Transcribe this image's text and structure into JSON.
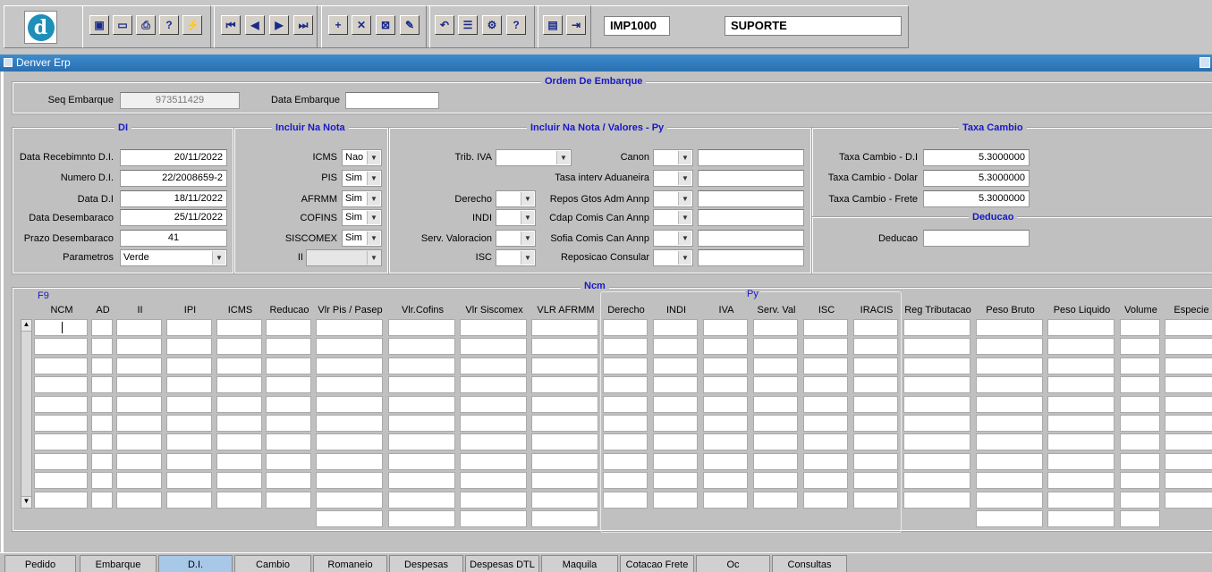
{
  "toolbar": {
    "module_code": "IMP1000",
    "user": "SUPORTE"
  },
  "window": {
    "title": "Denver Erp"
  },
  "ordem": {
    "title": "Ordem De Embarque",
    "seq_label": "Seq Embarque",
    "seq_value": "973511429",
    "data_label": "Data Embarque",
    "data_value": ""
  },
  "di": {
    "title": "DI",
    "rows": [
      {
        "label": "Data Recebimnto D.I.",
        "value": "20/11/2022"
      },
      {
        "label": "Numero D.I.",
        "value": "22/2008659-2"
      },
      {
        "label": "Data D.I",
        "value": "18/11/2022"
      },
      {
        "label": "Data Desembaraco",
        "value": "25/11/2022"
      },
      {
        "label": "Prazo Desembaraco",
        "value": "41"
      }
    ],
    "parametros_label": "Parametros",
    "parametros_value": "Verde"
  },
  "nota": {
    "title": "Incluir Na Nota",
    "rows": [
      {
        "label": "ICMS",
        "value": "Nao"
      },
      {
        "label": "PIS",
        "value": "Sim"
      },
      {
        "label": "AFRMM",
        "value": "Sim"
      },
      {
        "label": "COFINS",
        "value": "Sim"
      },
      {
        "label": "SISCOMEX",
        "value": "Sim"
      },
      {
        "label": "II",
        "value": ""
      }
    ]
  },
  "py": {
    "title": "Incluir Na Nota / Valores - Py",
    "left": [
      {
        "label": "Trib. IVA",
        "value": ""
      },
      {
        "label": "Derecho",
        "value": ""
      },
      {
        "label": "INDI",
        "value": ""
      },
      {
        "label": "Serv. Valoracion",
        "value": ""
      },
      {
        "label": "ISC",
        "value": ""
      }
    ],
    "right": [
      {
        "label": "Canon"
      },
      {
        "label": "Tasa interv Aduaneira"
      },
      {
        "label": "Repos Gtos Adm Annp"
      },
      {
        "label": "Cdap Comis Can Annp"
      },
      {
        "label": "Sofia Comis Can Annp"
      },
      {
        "label": "Reposicao Consular"
      }
    ]
  },
  "taxa": {
    "title": "Taxa Cambio",
    "rows": [
      {
        "label": "Taxa Cambio - D.I",
        "value": "5.3000000"
      },
      {
        "label": "Taxa Cambio - Dolar",
        "value": "5.3000000"
      },
      {
        "label": "Taxa Cambio - Frete",
        "value": "5.3000000"
      }
    ]
  },
  "deducao": {
    "title": "Deducao",
    "label": "Deducao",
    "value": ""
  },
  "ncm": {
    "title": "Ncm",
    "f9": "F9",
    "py_title": "Py",
    "columns": [
      "NCM",
      "AD",
      "II",
      "IPI",
      "ICMS",
      "Reducao",
      "Vlr Pis / Pasep",
      "Vlr.Cofins",
      "Vlr Siscomex",
      "VLR AFRMM",
      "Derecho",
      "INDI",
      "IVA",
      "Serv. Val",
      "ISC",
      "IRACIS",
      "Reg Tributacao",
      "Peso Bruto",
      "Peso Liquido",
      "Volume",
      "Especie"
    ]
  },
  "tabs": [
    "Pedido",
    "Embarque",
    "D.I.",
    "Cambio",
    "Romaneio",
    "Despesas",
    "Despesas DTL",
    "Maquila",
    "Cotacao Frete",
    "Oc",
    "Consultas"
  ],
  "active_tab": "D.I."
}
